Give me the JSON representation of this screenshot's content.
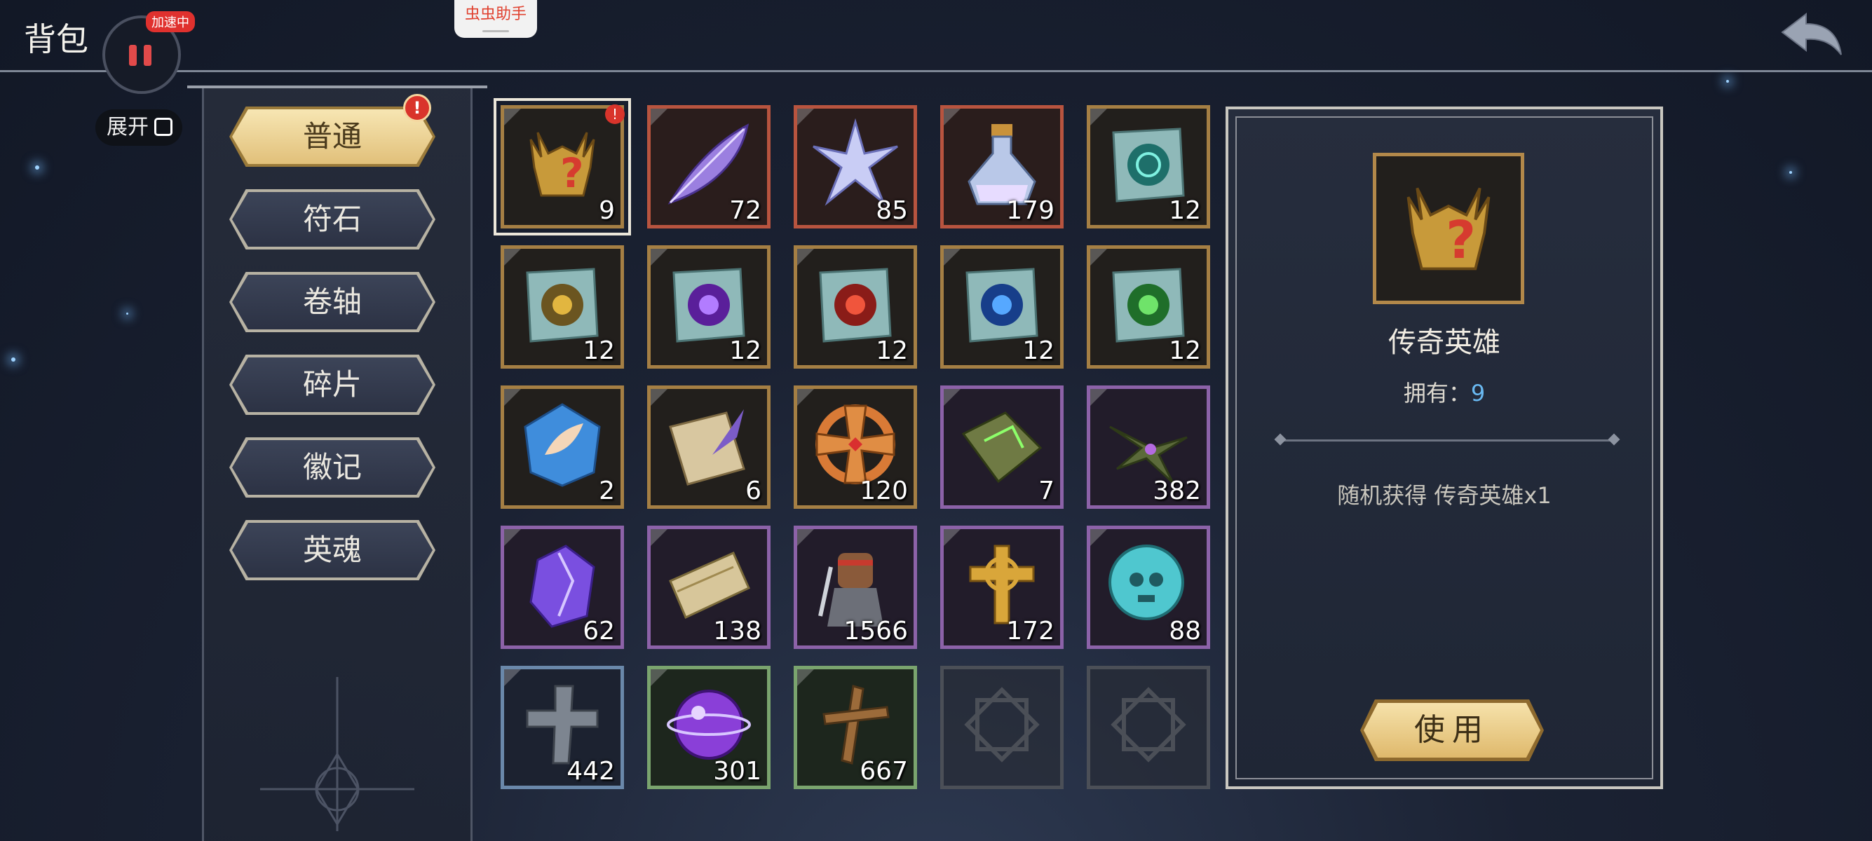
{
  "header": {
    "title": "背包",
    "accel_badge": "加速中",
    "helper_label": "虫虫助手"
  },
  "sidebar": {
    "expand_label": "展开",
    "categories": [
      {
        "label": "普通",
        "active": true,
        "alert": "!"
      },
      {
        "label": "符石"
      },
      {
        "label": "卷轴"
      },
      {
        "label": "碎片"
      },
      {
        "label": "徽记"
      },
      {
        "label": "英魂"
      }
    ]
  },
  "inventory": {
    "rows": [
      [
        {
          "icon": "legendary-hero-helmet-icon",
          "count": "9",
          "rarity": "gold",
          "selected": true,
          "alert": "!"
        },
        {
          "icon": "purple-feather-icon",
          "count": "72",
          "rarity": "red"
        },
        {
          "icon": "crystal-star-icon",
          "count": "85",
          "rarity": "red"
        },
        {
          "icon": "potion-bottle-icon",
          "count": "179",
          "rarity": "red"
        },
        {
          "icon": "teal-rune-scroll-icon",
          "count": "12",
          "rarity": "gold"
        }
      ],
      [
        {
          "icon": "gold-rune-scroll-icon",
          "count": "12",
          "rarity": "gold"
        },
        {
          "icon": "purple-rune-scroll-icon",
          "count": "12",
          "rarity": "gold"
        },
        {
          "icon": "red-rune-scroll-icon",
          "count": "12",
          "rarity": "gold"
        },
        {
          "icon": "blue-rune-scroll-icon",
          "count": "12",
          "rarity": "gold"
        },
        {
          "icon": "green-rune-scroll-icon",
          "count": "12",
          "rarity": "gold"
        }
      ],
      [
        {
          "icon": "blue-wing-emblem-icon",
          "count": "2",
          "rarity": "gold"
        },
        {
          "icon": "quill-scroll-icon",
          "count": "6",
          "rarity": "gold"
        },
        {
          "icon": "bronze-cross-icon",
          "count": "120",
          "rarity": "gold"
        },
        {
          "icon": "green-spellbook-icon",
          "count": "7",
          "rarity": "purple"
        },
        {
          "icon": "leaf-gem-icon",
          "count": "382",
          "rarity": "purple"
        }
      ],
      [
        {
          "icon": "purple-crystal-icon",
          "count": "62",
          "rarity": "purple"
        },
        {
          "icon": "tickets-icon",
          "count": "138",
          "rarity": "purple"
        },
        {
          "icon": "warrior-portrait-icon",
          "count": "1566",
          "rarity": "purple"
        },
        {
          "icon": "golden-cross-icon",
          "count": "172",
          "rarity": "purple"
        },
        {
          "icon": "skull-orb-icon",
          "count": "88",
          "rarity": "purple"
        }
      ],
      [
        {
          "icon": "stone-cross-icon",
          "count": "442",
          "rarity": "blue"
        },
        {
          "icon": "purple-orb-icon",
          "count": "301",
          "rarity": "green"
        },
        {
          "icon": "wooden-cross-icon",
          "count": "667",
          "rarity": "green"
        },
        {
          "empty": true
        },
        {
          "empty": true
        }
      ]
    ]
  },
  "detail": {
    "name": "传奇英雄",
    "own_label": "拥有：",
    "own_count": "9",
    "description": "随机获得 传奇英雄x1",
    "use_label": "使用"
  },
  "colors": {
    "gold_frame": "#a57f44",
    "red_frame": "#b8543f",
    "purple_frame": "#8c62a8",
    "blue_frame": "#6a88aa",
    "green_frame": "#7aa46e",
    "accent_text": "#69b8f0"
  }
}
